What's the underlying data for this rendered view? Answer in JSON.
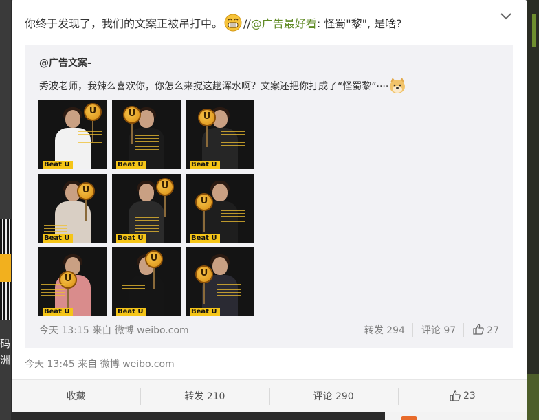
{
  "background": {
    "left_text": "码\n洲"
  },
  "post": {
    "text_before_emoji": "你终于发现了，我们的文案正被吊打中。",
    "emoji_grin": "grin-emoji",
    "text_separator": "//",
    "mention": "@广告最好看",
    "text_after_mention": ": 怪蜀\"黎\", 是啥?",
    "time_source": "今天 13:45 来自 微博 weibo.com",
    "actions": {
      "favorite": "收藏",
      "repost": "转发 210",
      "comment": "评论 290",
      "like": "23"
    }
  },
  "repost": {
    "author": "@广告文案-",
    "text": "秀波老师，我辣么喜欢你，你怎么来搅这趟浑水啊？文案还把你打成了“怪蜀黎”····",
    "emoji": "doge-emoji",
    "thumbnails": [
      {
        "beat_label": "Beat U",
        "outfit": "#f2f2f2"
      },
      {
        "beat_label": "Beat U",
        "outfit": "#1b1b1b"
      },
      {
        "beat_label": "Beat U",
        "outfit": "#262626"
      },
      {
        "beat_label": "Beat U",
        "outfit": "#d9cfc4"
      },
      {
        "beat_label": "Beat U",
        "outfit": "#2b2b2b"
      },
      {
        "beat_label": "Beat U",
        "outfit": "#1e1e1e"
      },
      {
        "beat_label": "Beat U",
        "outfit": "#d98c8c"
      },
      {
        "beat_label": "Beat U",
        "outfit": "#151515"
      },
      {
        "beat_label": "Beat U",
        "outfit": "#2a2a33"
      }
    ],
    "time_source": "今天 13:15 来自 微博 weibo.com",
    "actions": {
      "repost": "转发 294",
      "comment": "评论 97",
      "like": "27"
    }
  },
  "colors": {
    "mention": "#5e8a23",
    "meta_text": "#808080",
    "repost_bg": "#f2f2f5"
  }
}
